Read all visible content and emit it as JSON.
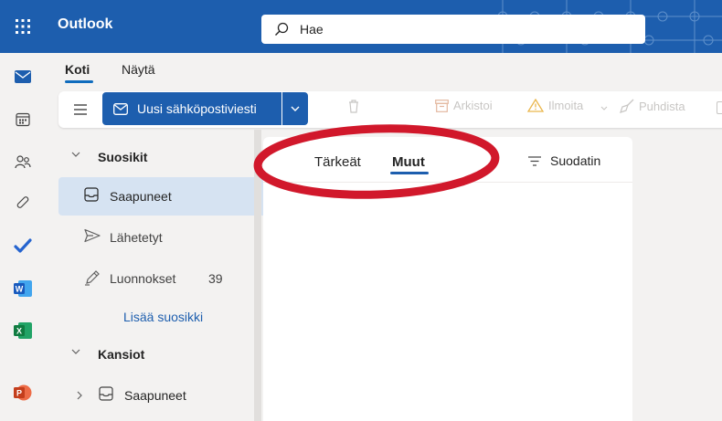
{
  "header": {
    "app_title": "Outlook",
    "search_placeholder": "Hae"
  },
  "ribbon": {
    "tabs": [
      {
        "label": "Koti",
        "active": true
      },
      {
        "label": "Näytä",
        "active": false
      }
    ],
    "new_mail_label": "Uusi sähköpostiviesti",
    "buttons": [
      {
        "label": "Arkistoi",
        "icon": "archive-icon"
      },
      {
        "label": "Ilmoita",
        "icon": "warning-icon"
      },
      {
        "label": "Puhdista",
        "icon": "broom-icon"
      }
    ]
  },
  "rail": {
    "items": [
      "mail-icon",
      "calendar-icon",
      "people-icon",
      "attach-icon",
      "todo-icon",
      "word-icon",
      "excel-icon",
      "powerpoint-icon"
    ]
  },
  "folders": {
    "favorites_label": "Suosikit",
    "favorites": [
      {
        "label": "Saapuneet",
        "icon": "inbox-icon",
        "selected": true
      },
      {
        "label": "Lähetetyt",
        "icon": "send-icon"
      },
      {
        "label": "Luonnokset",
        "icon": "draft-icon",
        "count": "39"
      }
    ],
    "add_favorite": "Lisää suosikki",
    "folders_label": "Kansiot",
    "folders": [
      {
        "label": "Saapuneet",
        "icon": "inbox-icon"
      }
    ]
  },
  "message_list": {
    "tabs": [
      {
        "label": "Tärkeät",
        "active": false
      },
      {
        "label": "Muut",
        "active": true
      }
    ],
    "filter_label": "Suodatin"
  },
  "colors": {
    "brand": "#1d5eae",
    "annotation": "#d1182b"
  }
}
